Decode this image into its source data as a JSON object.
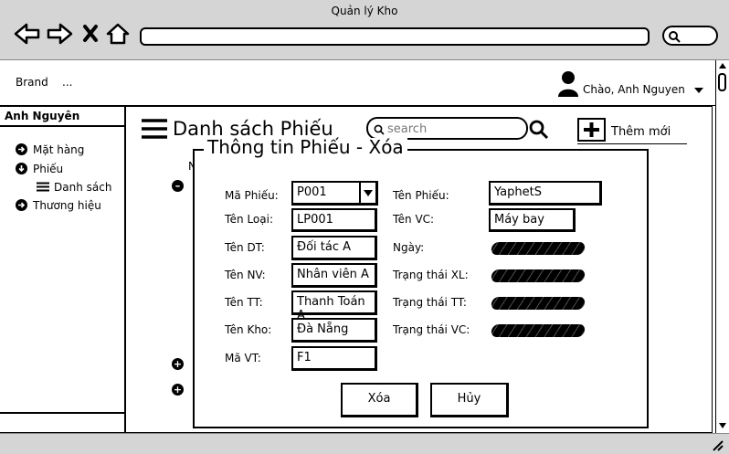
{
  "window": {
    "title": "Quản lý Kho"
  },
  "navbar": {
    "brand": "Brand",
    "more": "...",
    "greeting": "Chào, Anh Nguyen"
  },
  "sidebar": {
    "header": "Anh Nguyên",
    "items": [
      {
        "label": "Mặt hàng"
      },
      {
        "label": "Phiếu"
      },
      {
        "label": "Danh sách"
      },
      {
        "label": "Thương hiệu"
      }
    ]
  },
  "main": {
    "title": "Danh sách Phiếu",
    "search_placeholder": "search",
    "add_label": "Thêm mới",
    "partial_letter": "N"
  },
  "dialog": {
    "title": "Thông tin Phiếu - Xóa",
    "left": [
      {
        "label": "Mã Phiếu:",
        "value": "P001"
      },
      {
        "label": "Tên Loại:",
        "value": "LP001"
      },
      {
        "label": "Tên DT:",
        "value": "Đối tác A"
      },
      {
        "label": "Tên NV:",
        "value": "Nhân viên A"
      },
      {
        "label": "Tên TT:",
        "value": "Thanh Toán A"
      },
      {
        "label": "Tên Kho:",
        "value": "Đà Nẵng"
      },
      {
        "label": "Mã VT:",
        "value": "F1"
      }
    ],
    "right": [
      {
        "label": "Tên Phiếu:",
        "value": "YaphetS"
      },
      {
        "label": "Tên VC:",
        "value": "Máy bay"
      },
      {
        "label": "Ngày:"
      },
      {
        "label": "Trạng thái XL:"
      },
      {
        "label": "Trạng thái TT:"
      },
      {
        "label": "Trạng thái VC:"
      }
    ],
    "delete_label": "Xóa",
    "cancel_label": "Hủy"
  }
}
